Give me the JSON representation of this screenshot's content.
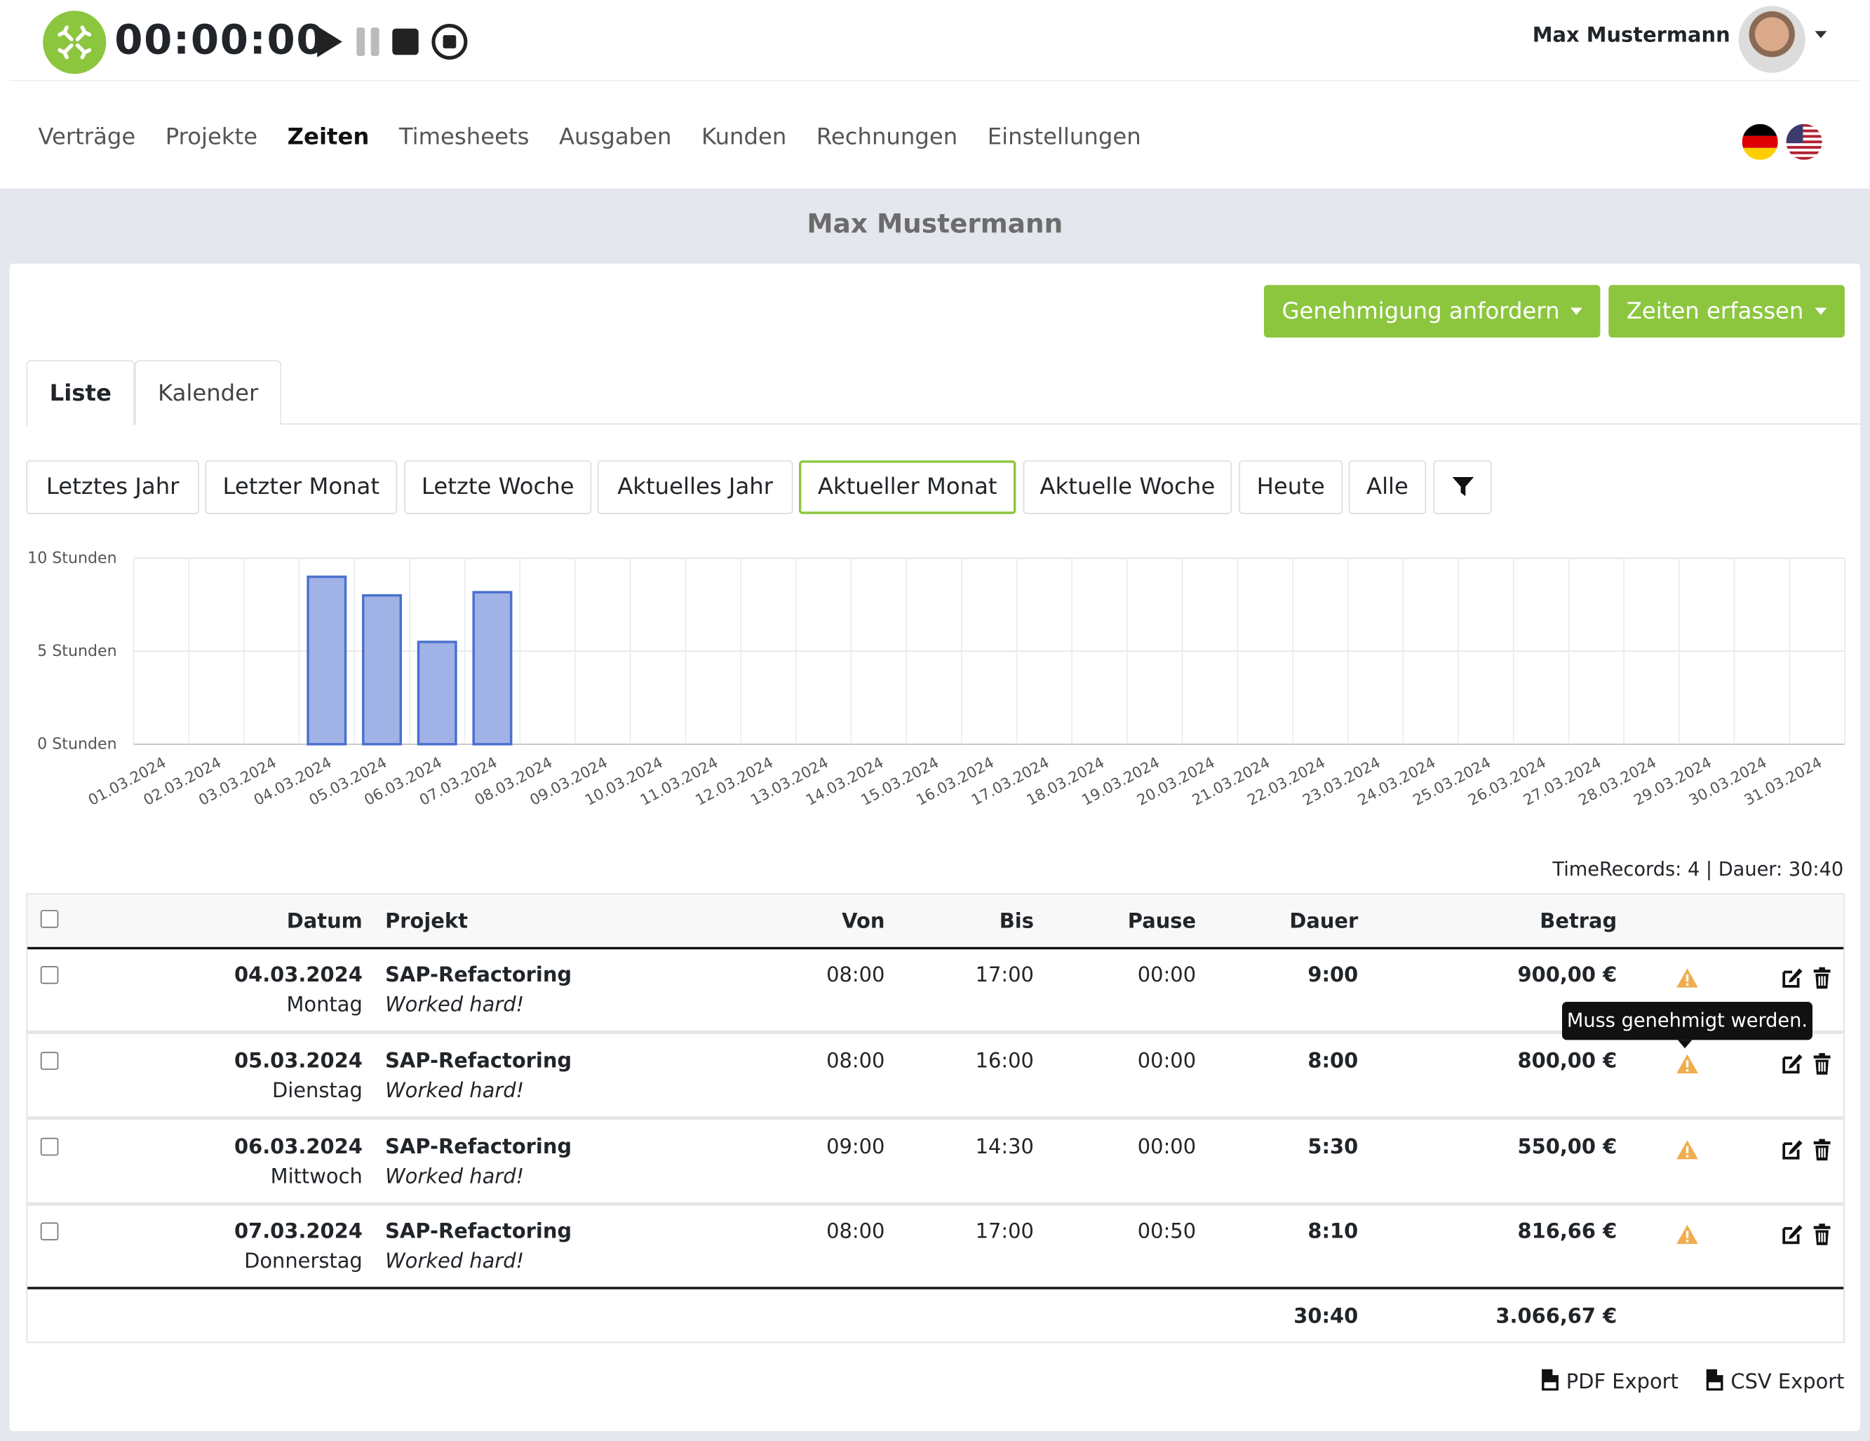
{
  "header": {
    "timer": "00:00:00",
    "user_name": "Max Mustermann",
    "logo_icon": "nexus-logo-icon",
    "controls": [
      "play-icon",
      "pause-icon",
      "stop-icon",
      "record-stop-icon"
    ]
  },
  "nav": {
    "items": [
      "Verträge",
      "Projekte",
      "Zeiten",
      "Timesheets",
      "Ausgaben",
      "Kunden",
      "Rechnungen",
      "Einstellungen"
    ],
    "active": "Zeiten",
    "languages": [
      "de-flag-icon",
      "us-flag-icon"
    ]
  },
  "page": {
    "title": "Max Mustermann",
    "btn_approval": "Genehmigung anfordern",
    "btn_record": "Zeiten erfassen"
  },
  "tabs": [
    "Liste",
    "Kalender"
  ],
  "filters": [
    "Letztes Jahr",
    "Letzter Monat",
    "Letzte Woche",
    "Aktuelles Jahr",
    "Aktueller Monat",
    "Aktuelle Woche",
    "Heute",
    "Alle"
  ],
  "selected_filter": "Aktueller Monat",
  "chart_data": {
    "type": "bar",
    "categories": [
      "01.03.2024",
      "02.03.2024",
      "03.03.2024",
      "04.03.2024",
      "05.03.2024",
      "06.03.2024",
      "07.03.2024",
      "08.03.2024",
      "09.03.2024",
      "10.03.2024",
      "11.03.2024",
      "12.03.2024",
      "13.03.2024",
      "14.03.2024",
      "15.03.2024",
      "16.03.2024",
      "17.03.2024",
      "18.03.2024",
      "19.03.2024",
      "20.03.2024",
      "21.03.2024",
      "22.03.2024",
      "23.03.2024",
      "24.03.2024",
      "25.03.2024",
      "26.03.2024",
      "27.03.2024",
      "28.03.2024",
      "29.03.2024",
      "30.03.2024",
      "31.03.2024"
    ],
    "values": [
      0,
      0,
      0,
      9,
      8,
      5.5,
      8.17,
      0,
      0,
      0,
      0,
      0,
      0,
      0,
      0,
      0,
      0,
      0,
      0,
      0,
      0,
      0,
      0,
      0,
      0,
      0,
      0,
      0,
      0,
      0,
      0
    ],
    "yticks": [
      "0 Stunden",
      "5 Stunden",
      "10 Stunden"
    ],
    "ylim": [
      0,
      10
    ],
    "grid": true,
    "bar_color": "#a0b2e6",
    "bar_border": "#4a6fd0"
  },
  "summary": "TimeRecords: 4 | Dauer: 30:40",
  "table": {
    "headers": {
      "datum": "Datum",
      "projekt": "Projekt",
      "von": "Von",
      "bis": "Bis",
      "pause": "Pause",
      "dauer": "Dauer",
      "betrag": "Betrag"
    },
    "rows": [
      {
        "date": "04.03.2024",
        "day": "Montag",
        "project": "SAP-Refactoring",
        "note": "Worked hard!",
        "von": "08:00",
        "bis": "17:00",
        "pause": "00:00",
        "dauer": "9:00",
        "betrag": "900,00 €"
      },
      {
        "date": "05.03.2024",
        "day": "Dienstag",
        "project": "SAP-Refactoring",
        "note": "Worked hard!",
        "von": "08:00",
        "bis": "16:00",
        "pause": "00:00",
        "dauer": "8:00",
        "betrag": "800,00 €"
      },
      {
        "date": "06.03.2024",
        "day": "Mittwoch",
        "project": "SAP-Refactoring",
        "note": "Worked hard!",
        "von": "09:00",
        "bis": "14:30",
        "pause": "00:00",
        "dauer": "5:30",
        "betrag": "550,00 €"
      },
      {
        "date": "07.03.2024",
        "day": "Donnerstag",
        "project": "SAP-Refactoring",
        "note": "Worked hard!",
        "von": "08:00",
        "bis": "17:00",
        "pause": "00:50",
        "dauer": "8:10",
        "betrag": "816,66 €"
      }
    ],
    "total_dauer": "30:40",
    "total_betrag": "3.066,67 €"
  },
  "tooltip": "Muss genehmigt werden.",
  "exports": {
    "pdf": "PDF Export",
    "csv": "CSV Export"
  },
  "colors": {
    "accent": "#8cc63f",
    "warning": "#f0ad4e",
    "background": "#e4e7ee"
  }
}
